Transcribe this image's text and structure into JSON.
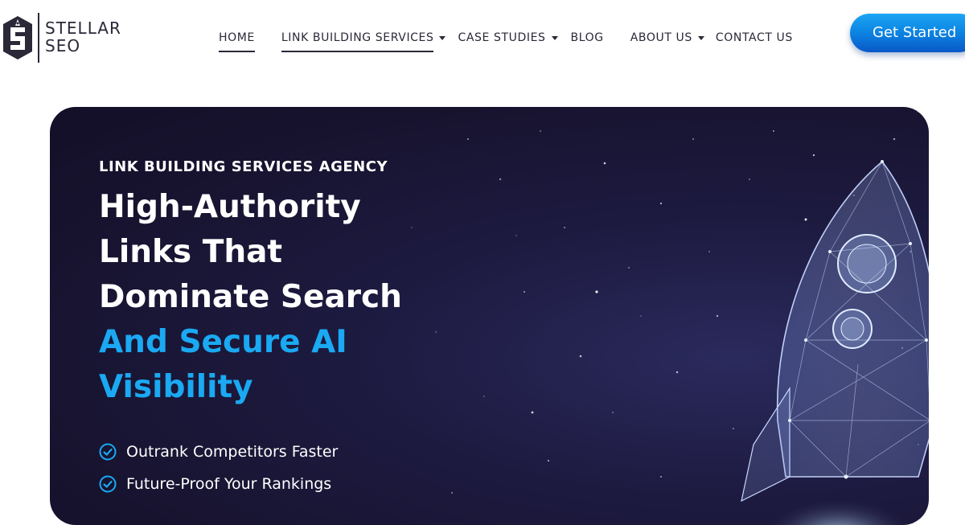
{
  "logo": {
    "line1": "STELLAR",
    "line2": "SEO",
    "icon": "rocket-shield-icon"
  },
  "nav": {
    "home": "HOME",
    "link_building": "LINK BUILDING SERVICES",
    "case_studies": "CASE STUDIES",
    "blog": "BLOG",
    "about": "ABOUT US",
    "contact": "CONTACT US"
  },
  "cta": {
    "label": "Get Started"
  },
  "hero": {
    "eyebrow": "LINK BUILDING SERVICES AGENCY",
    "headline_lines": [
      "High-Authority",
      "Links That",
      "Dominate Search"
    ],
    "accent_lines": [
      "And Secure AI",
      "Visibility"
    ],
    "benefits": [
      "Outrank Competitors Faster",
      "Future-Proof Your Rankings"
    ],
    "image": "wireframe-rocket-illustration"
  },
  "colors": {
    "accent": "#1aa9f2",
    "hero_bg": "#1b1738",
    "text_dark": "#2b2838",
    "button": "#0b7fe0"
  }
}
